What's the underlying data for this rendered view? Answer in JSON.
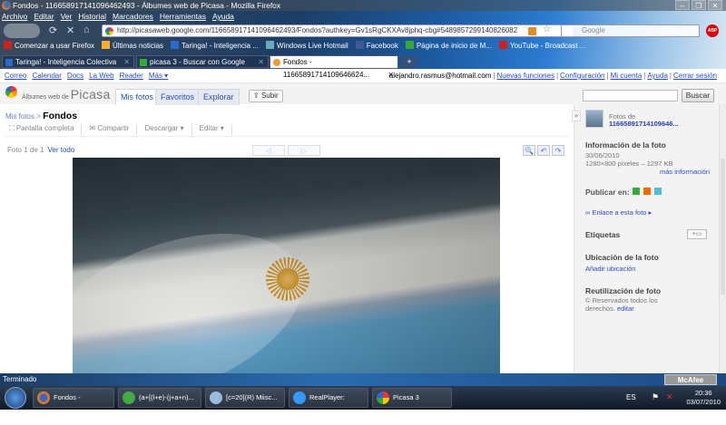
{
  "window": {
    "title": "Fondos - 116658917141096462493 - Álbumes web de Picasa - Mozilla Firefox"
  },
  "menu": [
    "Archivo",
    "Editar",
    "Ver",
    "Historial",
    "Marcadores",
    "Herramientas",
    "Ayuda"
  ],
  "url": "http://picasaweb.google.com/116658917141096462493/Fondos?authkey=Gv1sRgCKXAv8jphq-cbg#5489857299140826082",
  "search_placeholder": "Google",
  "bookmarks": [
    "Comenzar a usar Firefox",
    "Últimas noticias",
    "Taringa! - Inteligencia ...",
    "Windows Live Hotmail",
    "Facebook",
    "Página de inicio de M...",
    "YouTube - Broadcast ..."
  ],
  "tabs": [
    {
      "label": "Taringa! - Inteligencia Colectiva"
    },
    {
      "label": "picasa 3 - Buscar con Google"
    },
    {
      "label": "Fondos - 11665891714109646624..."
    }
  ],
  "gbar": {
    "links": [
      "Correo",
      "Calendar",
      "Docs",
      "La Web",
      "Reader",
      "Más ▾"
    ],
    "email": "alejandro.rasmus@hotmail.com",
    "right_links": [
      "Nuevas funciones",
      "Configuración",
      "Mi cuenta",
      "Ayuda",
      "Cerrar sesión"
    ]
  },
  "picasa": {
    "logo_small": "Álbumes web de",
    "logo_big": "Picasa",
    "tabs": [
      "Mis fotos",
      "Favoritos",
      "Explorar"
    ],
    "upload": "Subir",
    "search_button": "Buscar"
  },
  "breadcrumb": {
    "parent": "Mis fotos",
    "sep": ">",
    "current": "Fondos"
  },
  "toolbar": [
    "Pantalla completa",
    "Compartir",
    "Descargar ▾",
    "Editar ▾"
  ],
  "photo_count": "Foto 1 de 1",
  "view_all": "Ver todo",
  "sidebar": {
    "fotos_de": "Fotos de",
    "owner": "11665891714109646...",
    "info_title": "Información de la foto",
    "date": "30/06/2010",
    "size": "1280×800 píxeles – 1297 KB",
    "more_info": "más información",
    "publish": "Publicar en:",
    "link": "Enlace a esta foto ▸",
    "tags": "Etiquetas",
    "location_title": "Ubicación de la foto",
    "add_location": "Añadir ubicación",
    "reuse_title": "Reutilización de foto",
    "rights": "© Reservados todos los",
    "rights2": "derechos.",
    "edit": "editar"
  },
  "status": "Terminado",
  "mcafee": "McAfee",
  "taskbar": {
    "items": [
      "Fondos - 1166589...",
      "(a+[(l+e)-(j+a+n)...",
      "[c=20](R)   Miisc...",
      "RealPlayer: Richar...",
      "Picasa 3"
    ],
    "lang": "ES",
    "time": "20:36",
    "date": "03/07/2010"
  }
}
